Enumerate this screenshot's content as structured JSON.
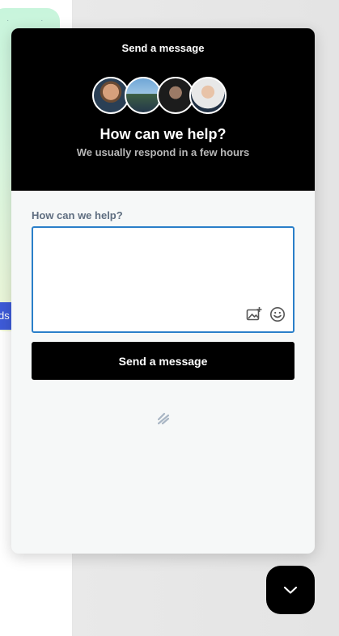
{
  "background": {
    "pill_text": "ds",
    "dots": "· ·"
  },
  "widget": {
    "header": {
      "title": "Send a message",
      "heading": "How can we help?",
      "subtitle": "We usually respond in a few hours",
      "avatars": [
        "avatar-1",
        "avatar-2",
        "avatar-3",
        "avatar-4"
      ]
    },
    "form": {
      "label": "How can we help?",
      "message_value": "",
      "message_placeholder": "",
      "image_tool_icon": "image-add-icon",
      "emoji_tool_icon": "emoji-icon",
      "send_label": "Send a message"
    },
    "footer": {
      "brand_icon": "brand-logo-icon"
    }
  },
  "launcher": {
    "icon": "chevron-down-icon"
  },
  "colors": {
    "header_bg": "#000000",
    "accent_border": "#2a7fc9",
    "label": "#5f6e80",
    "panel_bg": "#f6f8f8"
  }
}
